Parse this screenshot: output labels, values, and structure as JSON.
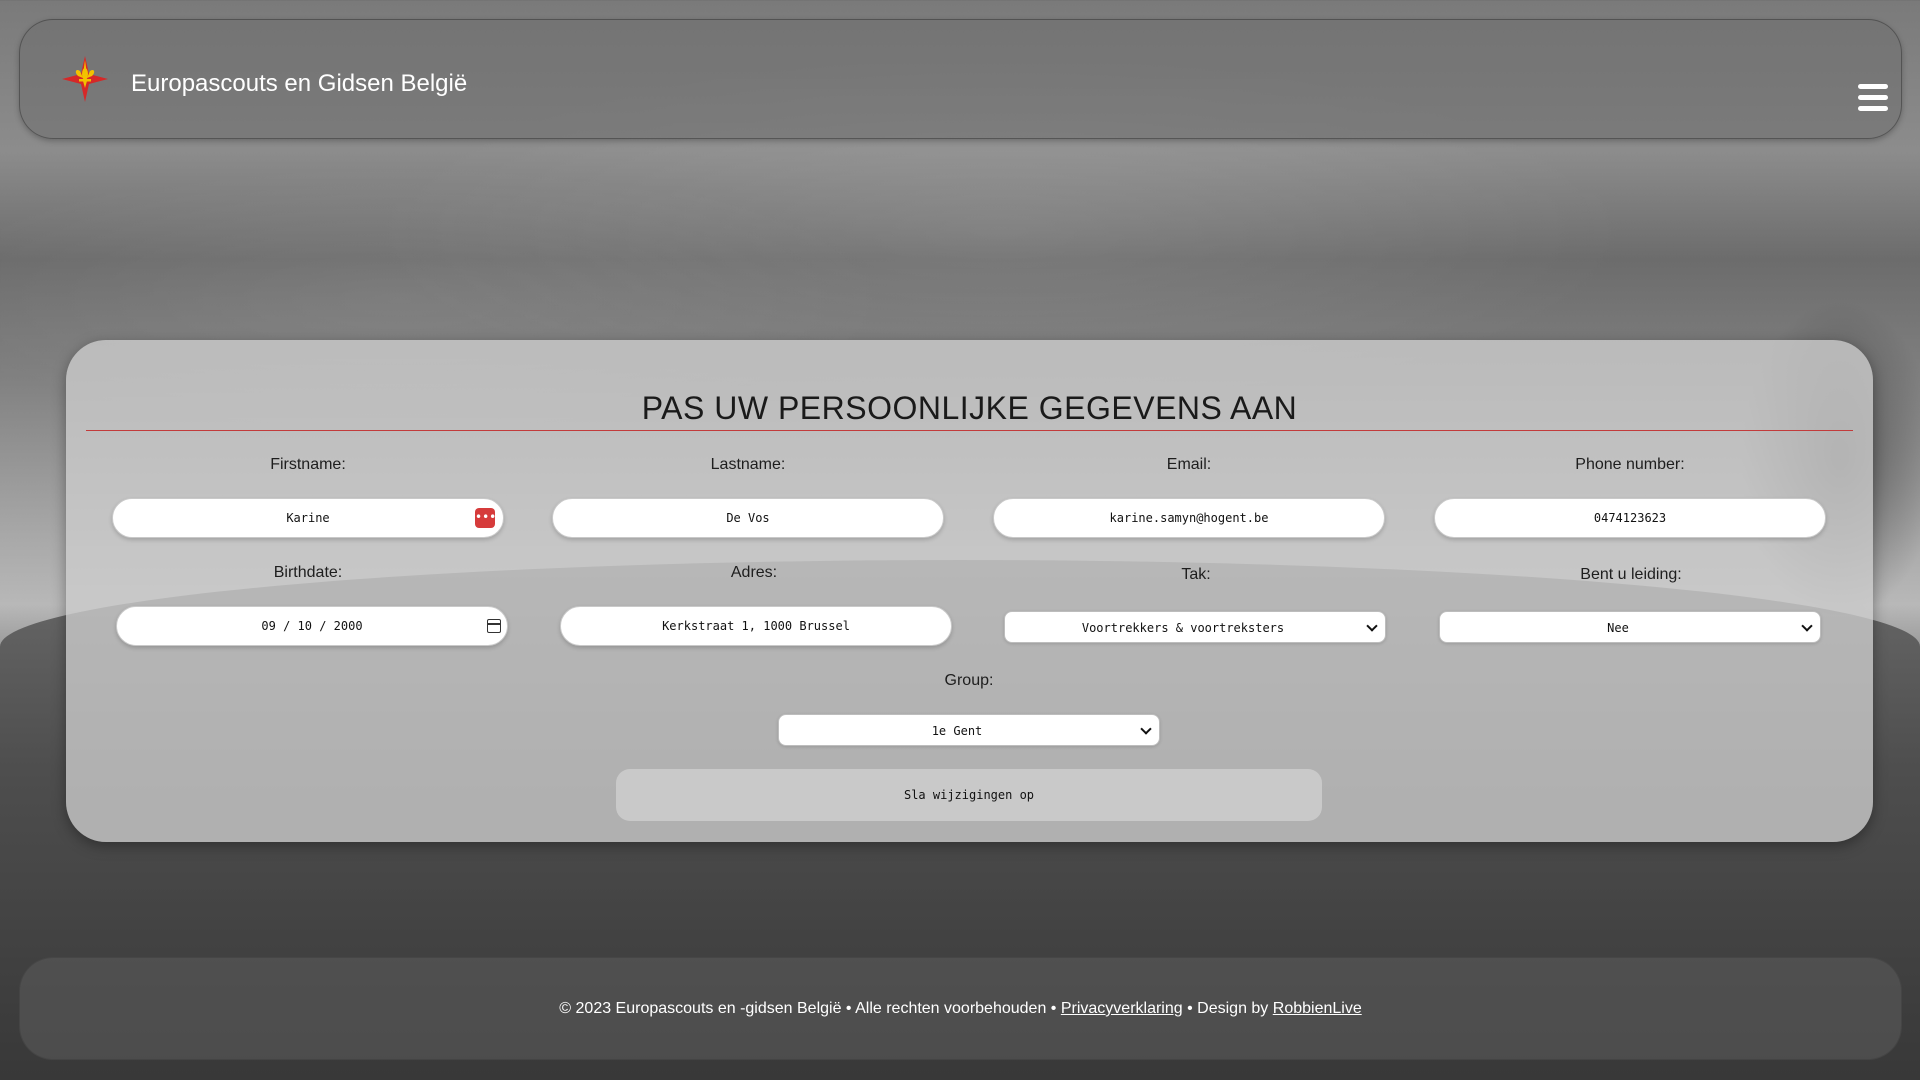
{
  "header": {
    "brand": "Europascouts en Gidsen België",
    "logo_icon": "fleur-de-lis-cross-logo",
    "menu_icon": "hamburger-menu-icon"
  },
  "form": {
    "title": "PAS UW PERSOONLIJKE GEGEVENS AAN",
    "fields": {
      "firstname": {
        "label": "Firstname:",
        "value": "Karine"
      },
      "lastname": {
        "label": "Lastname:",
        "value": "De Vos"
      },
      "email": {
        "label": "Email:",
        "value": "karine.samyn@hogent.be"
      },
      "phone": {
        "label": "Phone number:",
        "value": "0474123623"
      },
      "birthdate": {
        "label": "Birthdate:",
        "value": "09 / 10 / 2000"
      },
      "address": {
        "label": "Adres:",
        "value": "Kerkstraat 1, 1000 Brussel"
      },
      "tak": {
        "label": "Tak:",
        "selected": "Voortrekkers & voortreksters"
      },
      "leiding": {
        "label": "Bent u leiding:",
        "selected": "Nee"
      },
      "group": {
        "label": "Group:",
        "selected": "1e Gent"
      }
    },
    "save_label": "Sla wijzigingen op"
  },
  "footer": {
    "copyright": "© 2023 Europascouts en -gidsen België • Alle rechten voorbehouden •",
    "privacy_link": "Privacyverklaring",
    "design_text": "• Design by",
    "designer_link": "RobbienLive"
  },
  "colors": {
    "accent": "#c23b3b",
    "logo_red": "#d62828",
    "logo_gold": "#f2c200"
  }
}
